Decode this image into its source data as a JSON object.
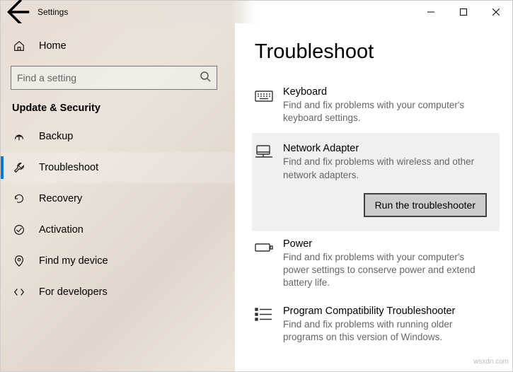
{
  "titlebar": {
    "app_title": "Settings"
  },
  "sidebar": {
    "home_label": "Home",
    "search_placeholder": "Find a setting",
    "section_header": "Update & Security",
    "items": [
      {
        "label": "Backup"
      },
      {
        "label": "Troubleshoot"
      },
      {
        "label": "Recovery"
      },
      {
        "label": "Activation"
      },
      {
        "label": "Find my device"
      },
      {
        "label": "For developers"
      }
    ]
  },
  "main": {
    "page_title": "Troubleshoot",
    "run_button": "Run the troubleshooter",
    "items": [
      {
        "title": "Keyboard",
        "desc": "Find and fix problems with your computer's keyboard settings."
      },
      {
        "title": "Network Adapter",
        "desc": "Find and fix problems with wireless and other network adapters."
      },
      {
        "title": "Power",
        "desc": "Find and fix problems with your computer's power settings to conserve power and extend battery life."
      },
      {
        "title": "Program Compatibility Troubleshooter",
        "desc": "Find and fix problems with running older programs on this version of Windows."
      }
    ]
  },
  "watermark": "wsxdn.com"
}
